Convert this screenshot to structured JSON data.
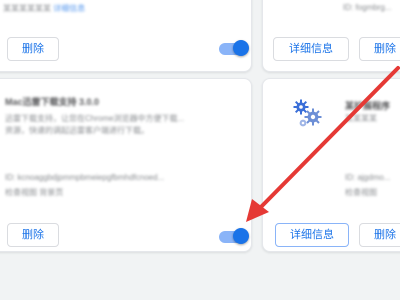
{
  "cards": {
    "top_left": {
      "desc_blur": "某某某某某某",
      "link_blur": "详细信息",
      "remove_label": "删除",
      "enabled": true
    },
    "top_right": {
      "details_label": "详细信息",
      "remove_label": "删除",
      "id_blur": "ID: fogmbrg..."
    },
    "bottom_left": {
      "title_blur": "Mac迅雷下载支持 3.0.0",
      "desc1_blur": "迅雷下载支持，让您在Chrome浏览器中方便下载...",
      "desc2_blur": "资源，快速的调起迅雷客户端进行下载。",
      "id_blur": "ID: kcnoaggbdjpmmpbmeiepgfbmhdfcnoed...",
      "view_blur": "检查视图 背景页",
      "remove_label": "删除",
      "enabled": true
    },
    "bottom_right": {
      "title_blur": "某扩展程序",
      "desc_blur": "某某某某",
      "id_blur": "ID: ajgdmo...",
      "view_blur": "检查视图",
      "details_label": "详细信息",
      "remove_label": "删除",
      "icon": "gears-icon"
    }
  },
  "colors": {
    "accent": "#1a73e8",
    "annotation_arrow": "#e53935"
  }
}
